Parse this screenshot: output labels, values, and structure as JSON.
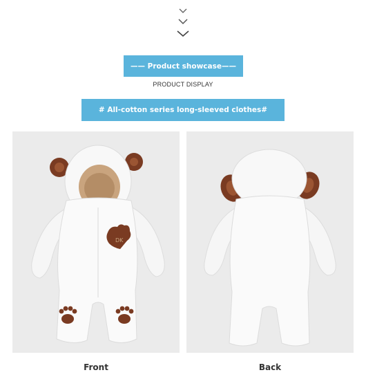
{
  "header": {
    "banner_title": "—— Product showcase——",
    "subtitle": "PRODUCT DISPLAY",
    "series_banner": "# All-cotton series long-sleeved clothes#"
  },
  "gallery": {
    "front": {
      "caption": "Front",
      "badge_text": "DK"
    },
    "back": {
      "caption": "Back"
    }
  },
  "colors": {
    "banner": "#5ab4dc",
    "panel_bg": "#ebebeb",
    "fur": "#f8f8f8",
    "brown": "#7a3b22",
    "lining": "#c9a47e"
  },
  "icons": {
    "scroll_hint": "triple-chevron-down-icon",
    "paw": "paw-print-icon"
  }
}
